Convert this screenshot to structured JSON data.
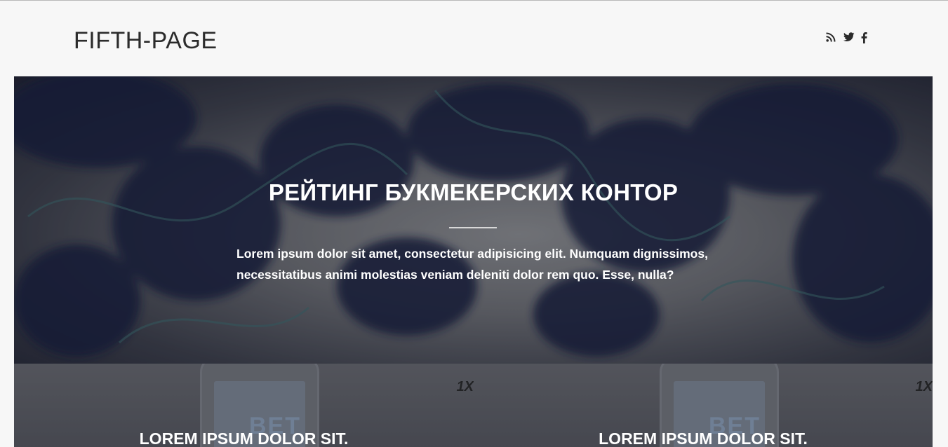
{
  "header": {
    "logo": "FIFTH-PAGE",
    "social": [
      {
        "icon": "rss-icon"
      },
      {
        "icon": "twitter-icon"
      },
      {
        "icon": "facebook-icon"
      }
    ]
  },
  "hero": {
    "title": "РЕЙТИНГ БУКМЕКЕРСКИХ КОНТОР",
    "text": "Lorem ipsum dolor sit amet, consectetur adipisicing elit. Numquam dignissimos, necessitatibus animi molestias veniam deleniti dolor rem quo. Esse, nulla?"
  },
  "cards": [
    {
      "title": "LOREM IPSUM DOLOR SIT.",
      "brand": "1X",
      "screen_text": "BET"
    },
    {
      "title": "LOREM IPSUM DOLOR SIT.",
      "brand": "1X",
      "screen_text": "BET"
    }
  ],
  "colors": {
    "background": "#f7f7f7",
    "logo_text": "#2b2b2b",
    "hero_text": "#ffffff"
  }
}
